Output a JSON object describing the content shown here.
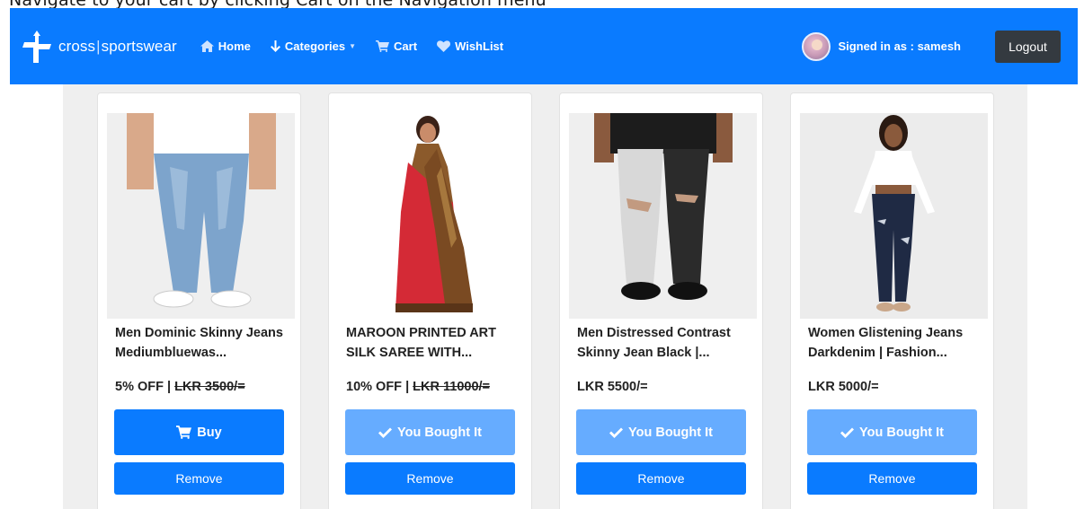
{
  "caption": "Navigate to your cart by clicking Cart on the Navigation menu",
  "navbar": {
    "brand_left": "cross",
    "brand_sep": "|",
    "brand_right": "sportswear",
    "links": [
      {
        "label": "Home",
        "icon": "home-icon"
      },
      {
        "label": "Categories",
        "icon": "arrow-down-icon"
      },
      {
        "label": "Cart",
        "icon": "cart-icon"
      },
      {
        "label": "WishList",
        "icon": "heart-icon"
      }
    ],
    "signed_in": "Signed in as : samesh",
    "logout_label": "Logout"
  },
  "colors": {
    "primary": "#0a7bff",
    "primary_light": "#66acff",
    "dark": "#343a40",
    "content_bg": "#efefef"
  },
  "products": [
    {
      "title": "Men Dominic Skinny Jeans Mediumbluewas...",
      "discount": "5% OFF | ",
      "price": "",
      "old_price": "LKR 3500/=",
      "action_label": "Buy",
      "action_icon": "cart-icon",
      "bought": false,
      "remove_label": "Remove"
    },
    {
      "title": "MAROON PRINTED ART SILK SAREE WITH...",
      "discount": "10% OFF | ",
      "price": "",
      "old_price": "LKR 11000/=",
      "action_label": "You Bought It",
      "action_icon": "check-icon",
      "bought": true,
      "remove_label": "Remove"
    },
    {
      "title": "Men Distressed Contrast Skinny Jean Black |...",
      "discount": "",
      "price": "LKR 5500/=",
      "old_price": "",
      "action_label": "You Bought It",
      "action_icon": "check-icon",
      "bought": true,
      "remove_label": "Remove"
    },
    {
      "title": "Women Glistening Jeans Darkdenim | Fashion...",
      "discount": "",
      "price": "LKR 5000/=",
      "old_price": "",
      "action_label": "You Bought It",
      "action_icon": "check-icon",
      "bought": true,
      "remove_label": "Remove"
    }
  ]
}
